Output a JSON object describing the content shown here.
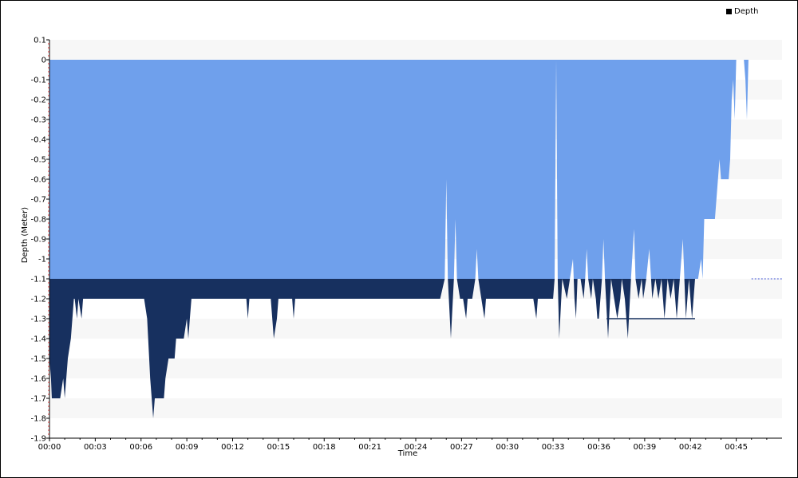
{
  "chart_data": {
    "type": "area",
    "title": "",
    "xlabel": "Time",
    "ylabel": "Depth (Meter)",
    "legend": {
      "position": "top-right",
      "entries": [
        "Depth"
      ]
    },
    "grid": "horizontal alternating bands",
    "xlim": [
      0,
      48
    ],
    "ylim": [
      -1.9,
      0.1
    ],
    "xticks": [
      "00:00",
      "00:03",
      "00:06",
      "00:09",
      "00:12",
      "00:15",
      "00:18",
      "00:21",
      "00:24",
      "00:27",
      "00:30",
      "00:33",
      "00:36",
      "00:39",
      "00:42",
      "00:45"
    ],
    "yticks": [
      "0.1",
      "0",
      "-0.1",
      "-0.2",
      "-0.3",
      "-0.4",
      "-0.5",
      "-0.6",
      "-0.7",
      "-0.8",
      "-0.9",
      "-1",
      "-1.1",
      "-1.2",
      "-1.3",
      "-1.4",
      "-1.5",
      "-1.6",
      "-1.7",
      "-1.8",
      "-1.9"
    ],
    "reference_line": {
      "value": -1.1,
      "style": "dotted"
    },
    "colors": {
      "above": "#6fa0ec",
      "below": "#17305f",
      "band": "#f7f7f7"
    },
    "series": [
      {
        "name": "Depth",
        "points": [
          [
            0.0,
            -1.5
          ],
          [
            0.1,
            -1.6
          ],
          [
            0.15,
            -1.7
          ],
          [
            0.7,
            -1.7
          ],
          [
            0.9,
            -1.6
          ],
          [
            1.0,
            -1.7
          ],
          [
            1.2,
            -1.5
          ],
          [
            1.4,
            -1.4
          ],
          [
            1.5,
            -1.3
          ],
          [
            1.6,
            -1.2
          ],
          [
            1.65,
            -1.2
          ],
          [
            1.8,
            -1.3
          ],
          [
            1.9,
            -1.2
          ],
          [
            2.1,
            -1.3
          ],
          [
            2.2,
            -1.2
          ],
          [
            6.2,
            -1.2
          ],
          [
            6.4,
            -1.3
          ],
          [
            6.6,
            -1.6
          ],
          [
            6.8,
            -1.8
          ],
          [
            6.9,
            -1.7
          ],
          [
            7.5,
            -1.7
          ],
          [
            7.6,
            -1.6
          ],
          [
            7.8,
            -1.5
          ],
          [
            8.2,
            -1.5
          ],
          [
            8.3,
            -1.4
          ],
          [
            8.8,
            -1.4
          ],
          [
            9.0,
            -1.3
          ],
          [
            9.1,
            -1.4
          ],
          [
            9.2,
            -1.3
          ],
          [
            9.3,
            -1.2
          ],
          [
            12.9,
            -1.2
          ],
          [
            13.0,
            -1.3
          ],
          [
            13.1,
            -1.2
          ],
          [
            14.5,
            -1.2
          ],
          [
            14.7,
            -1.4
          ],
          [
            14.9,
            -1.3
          ],
          [
            15.0,
            -1.2
          ],
          [
            15.9,
            -1.2
          ],
          [
            16.0,
            -1.3
          ],
          [
            16.1,
            -1.2
          ],
          [
            25.6,
            -1.2
          ],
          [
            25.9,
            -1.1
          ],
          [
            26.0,
            -0.6
          ],
          [
            26.1,
            -1.1
          ],
          [
            26.3,
            -1.4
          ],
          [
            26.5,
            -1.1
          ],
          [
            26.6,
            -0.8
          ],
          [
            26.7,
            -1.1
          ],
          [
            26.9,
            -1.2
          ],
          [
            27.1,
            -1.2
          ],
          [
            27.3,
            -1.3
          ],
          [
            27.4,
            -1.2
          ],
          [
            27.7,
            -1.2
          ],
          [
            27.9,
            -1.1
          ],
          [
            28.0,
            -0.95
          ],
          [
            28.1,
            -1.1
          ],
          [
            28.3,
            -1.2
          ],
          [
            28.5,
            -1.3
          ],
          [
            28.6,
            -1.2
          ],
          [
            31.7,
            -1.2
          ],
          [
            31.9,
            -1.3
          ],
          [
            32.0,
            -1.2
          ],
          [
            33.0,
            -1.2
          ],
          [
            33.1,
            -1.1
          ],
          [
            33.2,
            0.0
          ],
          [
            33.3,
            -1.1
          ],
          [
            33.4,
            -1.4
          ],
          [
            33.6,
            -1.1
          ],
          [
            33.9,
            -1.2
          ],
          [
            34.1,
            -1.1
          ],
          [
            34.3,
            -1.0
          ],
          [
            34.4,
            -1.2
          ],
          [
            34.5,
            -1.3
          ],
          [
            34.6,
            -1.1
          ],
          [
            34.8,
            -1.1
          ],
          [
            35.0,
            -1.2
          ],
          [
            35.1,
            -1.1
          ],
          [
            35.2,
            -0.95
          ],
          [
            35.3,
            -1.1
          ],
          [
            35.5,
            -1.2
          ],
          [
            35.6,
            -1.1
          ],
          [
            35.8,
            -1.2
          ],
          [
            35.9,
            -1.3
          ],
          [
            36.0,
            -1.3
          ],
          [
            36.2,
            -1.1
          ],
          [
            36.3,
            -0.9
          ],
          [
            36.4,
            -1.1
          ],
          [
            36.6,
            -1.4
          ],
          [
            36.8,
            -1.1
          ],
          [
            37.0,
            -1.2
          ],
          [
            37.2,
            -1.3
          ],
          [
            37.4,
            -1.2
          ],
          [
            37.5,
            -1.1
          ],
          [
            37.7,
            -1.2
          ],
          [
            37.9,
            -1.4
          ],
          [
            38.1,
            -1.1
          ],
          [
            38.3,
            -0.85
          ],
          [
            38.4,
            -1.1
          ],
          [
            38.6,
            -1.2
          ],
          [
            38.8,
            -1.1
          ],
          [
            38.9,
            -1.2
          ],
          [
            39.1,
            -1.1
          ],
          [
            39.3,
            -0.95
          ],
          [
            39.5,
            -1.2
          ],
          [
            39.7,
            -1.1
          ],
          [
            39.9,
            -1.2
          ],
          [
            40.1,
            -1.1
          ],
          [
            40.2,
            -1.2
          ],
          [
            40.3,
            -1.3
          ],
          [
            40.5,
            -1.1
          ],
          [
            40.7,
            -1.2
          ],
          [
            40.9,
            -1.1
          ],
          [
            41.1,
            -1.3
          ],
          [
            41.3,
            -1.1
          ],
          [
            41.5,
            -0.9
          ],
          [
            41.6,
            -1.1
          ],
          [
            41.7,
            -1.3
          ],
          [
            41.9,
            -1.1
          ],
          [
            42.1,
            -1.3
          ],
          [
            42.3,
            -1.1
          ],
          [
            42.5,
            -1.1
          ],
          [
            42.7,
            -1.0
          ],
          [
            42.8,
            -1.1
          ],
          [
            42.9,
            -0.8
          ],
          [
            43.0,
            -0.8
          ],
          [
            43.1,
            -0.8
          ],
          [
            43.6,
            -0.8
          ],
          [
            43.8,
            -0.6
          ],
          [
            43.9,
            -0.5
          ],
          [
            44.0,
            -0.6
          ],
          [
            44.5,
            -0.6
          ],
          [
            44.6,
            -0.5
          ],
          [
            44.7,
            -0.2
          ],
          [
            44.8,
            -0.1
          ],
          [
            44.9,
            -0.3
          ],
          [
            45.0,
            0.0
          ],
          [
            45.5,
            0.0
          ],
          [
            45.6,
            -0.1
          ],
          [
            45.7,
            -0.3
          ],
          [
            45.8,
            0.0
          ],
          [
            46.0,
            0.0
          ]
        ]
      }
    ],
    "flat_segment": {
      "x": [
        36.5,
        42.3
      ],
      "y": -1.3
    }
  }
}
